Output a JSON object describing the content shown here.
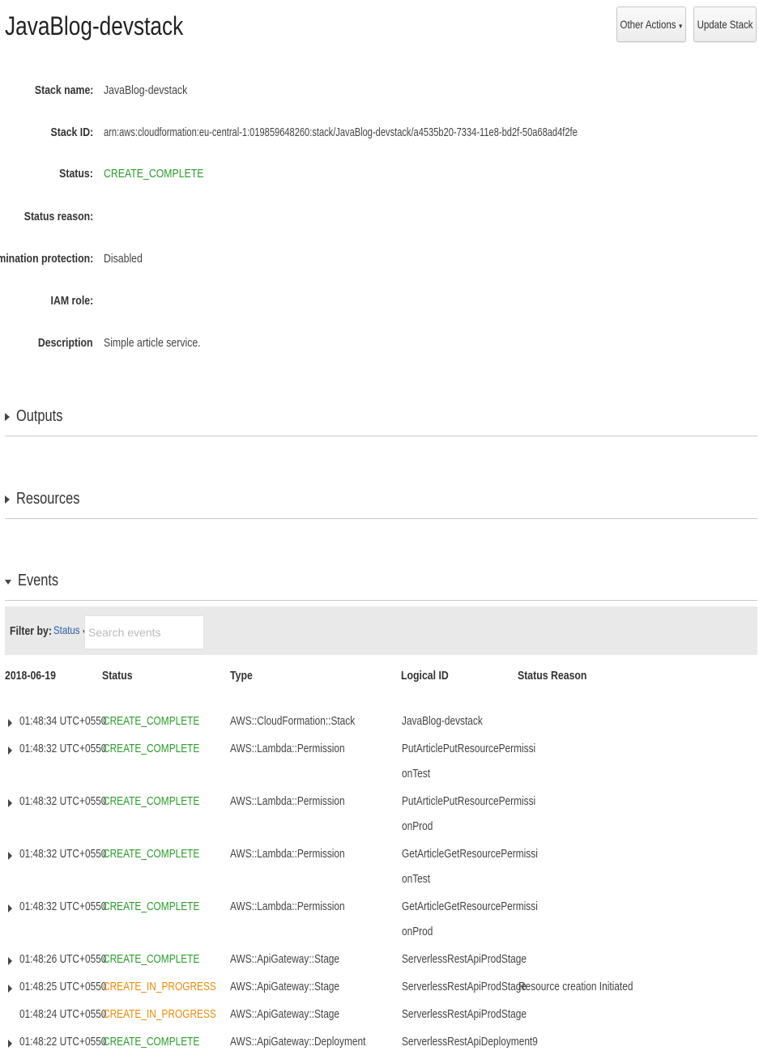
{
  "header": {
    "title": "JavaBlog-devstack",
    "other_actions_label": "Other Actions",
    "update_stack_label": "Update Stack"
  },
  "details": [
    {
      "label": "Stack name:",
      "value": "JavaBlog-devstack",
      "status_color": ""
    },
    {
      "label": "Stack ID:",
      "value": "arn:aws:cloudformation:eu-central-1:019859648260:stack/JavaBlog-devstack/a4535b20-7334-11e8-bd2f-50a68ad4f2fe",
      "status_color": ""
    },
    {
      "label": "Status:",
      "value": "CREATE_COMPLETE",
      "status_color": "#2a9d2a"
    },
    {
      "label": "Status reason:",
      "value": "",
      "status_color": ""
    },
    {
      "label": "Termination protection:",
      "value": "Disabled",
      "status_color": ""
    },
    {
      "label": "IAM role:",
      "value": "",
      "status_color": ""
    },
    {
      "label": "Description",
      "value": "Simple article service.",
      "status_color": ""
    }
  ],
  "sections": {
    "outputs": {
      "label": "Outputs",
      "expanded": false
    },
    "resources": {
      "label": "Resources",
      "expanded": false
    },
    "events": {
      "label": "Events",
      "expanded": true
    }
  },
  "filter": {
    "label": "Filter by:",
    "status_selected": "Status",
    "search_placeholder": "Search events",
    "search_value": ""
  },
  "events_table": {
    "columns": [
      "2018-06-19",
      "Status",
      "Type",
      "Logical ID",
      "Status Reason"
    ],
    "rows": [
      {
        "time": "01:48:34 UTC+0550",
        "status": "CREATE_COMPLETE",
        "type": "AWS::CloudFormation::Stack",
        "logical_id": [
          "JavaBlog-devstack"
        ],
        "reason": "",
        "expandable": true
      },
      {
        "time": "01:48:32 UTC+0550",
        "status": "CREATE_COMPLETE",
        "type": "AWS::Lambda::Permission",
        "logical_id": [
          "PutArticlePutResourcePermissi",
          "onTest"
        ],
        "reason": "",
        "expandable": true
      },
      {
        "time": "01:48:32 UTC+0550",
        "status": "CREATE_COMPLETE",
        "type": "AWS::Lambda::Permission",
        "logical_id": [
          "PutArticlePutResourcePermissi",
          "onProd"
        ],
        "reason": "",
        "expandable": true
      },
      {
        "time": "01:48:32 UTC+0550",
        "status": "CREATE_COMPLETE",
        "type": "AWS::Lambda::Permission",
        "logical_id": [
          "GetArticleGetResourcePermissi",
          "onTest"
        ],
        "reason": "",
        "expandable": true
      },
      {
        "time": "01:48:32 UTC+0550",
        "status": "CREATE_COMPLETE",
        "type": "AWS::Lambda::Permission",
        "logical_id": [
          "GetArticleGetResourcePermissi",
          "onProd"
        ],
        "reason": "",
        "expandable": true
      },
      {
        "time": "01:48:26 UTC+0550",
        "status": "CREATE_COMPLETE",
        "type": "AWS::ApiGateway::Stage",
        "logical_id": [
          "ServerlessRestApiProdStage"
        ],
        "reason": "",
        "expandable": true
      },
      {
        "time": "01:48:25 UTC+0550",
        "status": "CREATE_IN_PROGRESS",
        "type": "AWS::ApiGateway::Stage",
        "logical_id": [
          "ServerlessRestApiProdStage"
        ],
        "reason": "Resource creation Initiated",
        "expandable": true
      },
      {
        "time": "01:48:24 UTC+0550",
        "status": "CREATE_IN_PROGRESS",
        "type": "AWS::ApiGateway::Stage",
        "logical_id": [
          "ServerlessRestApiProdStage"
        ],
        "reason": "",
        "expandable": false
      },
      {
        "time": "01:48:22 UTC+0550",
        "status": "CREATE_COMPLETE",
        "type": "AWS::ApiGateway::Deployment",
        "logical_id": [
          "ServerlessRestApiDeployment9"
        ],
        "reason": "",
        "expandable": true
      }
    ]
  },
  "colors": {
    "complete": "#2a9d2a",
    "in_progress": "#ec8b0b",
    "link": "#2a5db0"
  }
}
